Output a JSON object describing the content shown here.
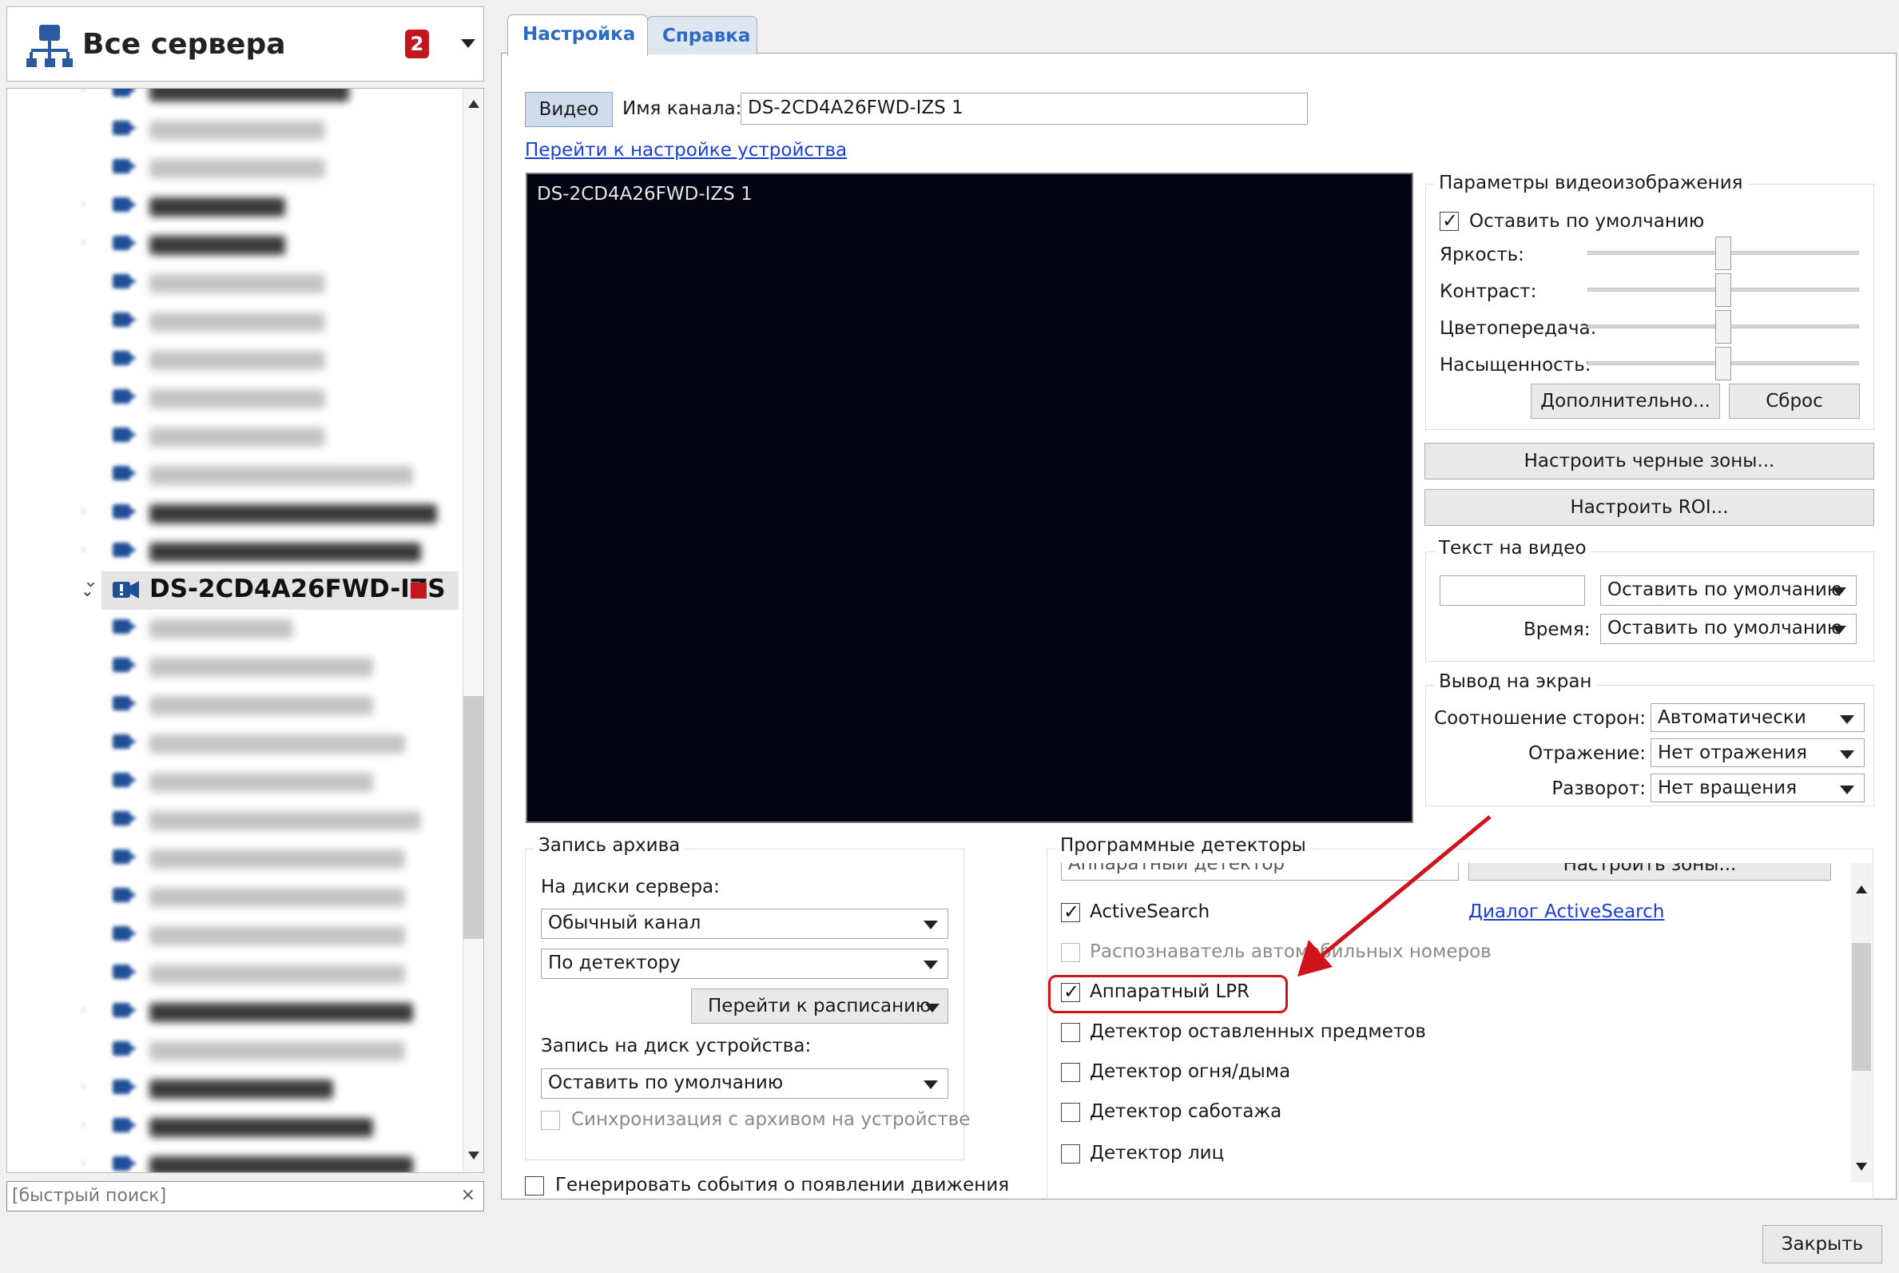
{
  "sidebar": {
    "title": "Все сервера",
    "badge": "2",
    "selected_item": "DS-2CD4A26FWD-IZS",
    "search_placeholder": "[быстрый поиск]"
  },
  "tabs": [
    "Настройка",
    "Справка"
  ],
  "channel": {
    "video_button": "Видео",
    "name_label": "Имя канала:",
    "name_value": "DS-2CD4A26FWD-IZS 1",
    "device_link": "Перейти к настройке устройства",
    "video_overlay": "DS-2CD4A26FWD-IZS 1"
  },
  "image_params": {
    "title": "Параметры видеоизображения",
    "default_label": "Оставить по умолчанию",
    "default_checked": true,
    "sliders": [
      {
        "label": "Яркость:",
        "value": 0.5
      },
      {
        "label": "Контраст:",
        "value": 0.5
      },
      {
        "label": "Цветопередача:",
        "value": 0.5
      },
      {
        "label": "Насыщенность:",
        "value": 0.5
      }
    ],
    "more_button": "Дополнительно...",
    "reset_button": "Сброс"
  },
  "black_zones_button": "Настроить черные зоны...",
  "roi_button": "Настроить ROI...",
  "text_on_video": {
    "title": "Текст на видео",
    "text_value": "",
    "text_select": "Оставить по умолчанию",
    "time_label": "Время:",
    "time_select": "Оставить по умолчанию"
  },
  "display": {
    "title": "Вывод на экран",
    "rows": [
      {
        "label": "Соотношение сторон:",
        "value": "Автоматически"
      },
      {
        "label": "Отражение:",
        "value": "Нет отражения"
      },
      {
        "label": "Разворот:",
        "value": "Нет вращения"
      }
    ]
  },
  "archive": {
    "title": "Запись архива",
    "server_label": "На диски сервера:",
    "channel_select": "Обычный канал",
    "detector_select": "По детектору",
    "schedule_button": "Перейти к расписанию",
    "device_label": "Запись на диск устройства:",
    "device_select": "Оставить по умолчанию",
    "sync_label": "Синхронизация с архивом на устройстве"
  },
  "motion_events_label": "Генерировать события о появлении движения",
  "detectors": {
    "title": "Программные детекторы",
    "header_partial": "Аппаратный детектор",
    "header_button_partial": "Настроить зоны...",
    "items": [
      {
        "label": "ActiveSearch",
        "checked": true,
        "enabled": true
      },
      {
        "label": "Распознаватель автомобильных номеров",
        "checked": false,
        "enabled": false
      },
      {
        "label": "Аппаратный LPR",
        "checked": true,
        "enabled": true
      },
      {
        "label": "Детектор оставленных предметов",
        "checked": false,
        "enabled": true
      },
      {
        "label": "Детектор огня/дыма",
        "checked": false,
        "enabled": true
      },
      {
        "label": "Детектор саботажа",
        "checked": false,
        "enabled": true
      },
      {
        "label": "Детектор лиц",
        "checked": false,
        "enabled": true
      }
    ],
    "activesearch_link": "Диалог ActiveSearch"
  },
  "close_button": "Закрыть",
  "colors": {
    "highlight": "#d0141c",
    "link": "#1a3fd6",
    "badge": "#c0181e",
    "tab_text": "#2b6bc3"
  }
}
